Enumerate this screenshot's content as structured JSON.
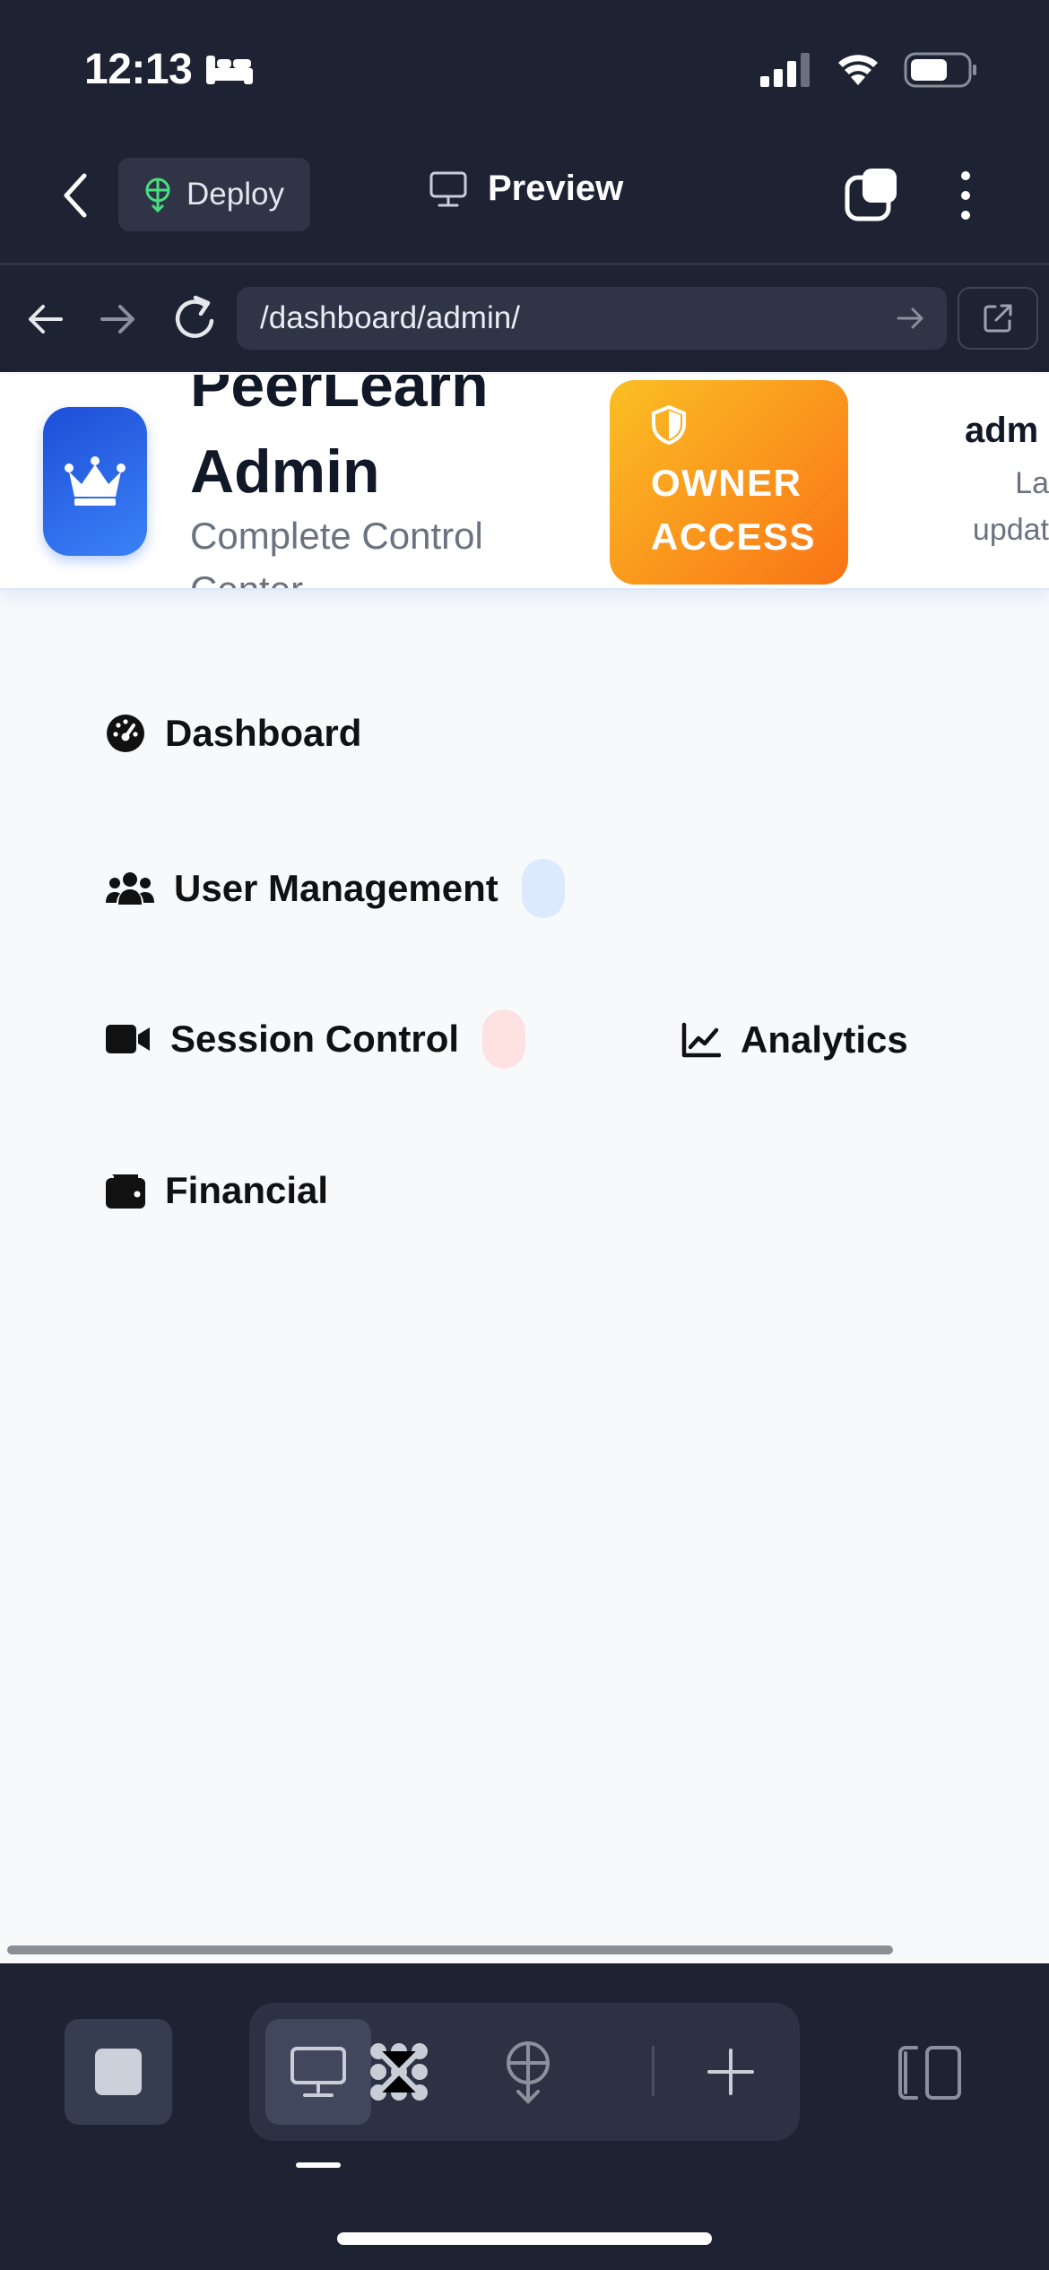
{
  "status_bar": {
    "time": "12:13"
  },
  "app_header": {
    "deploy_label": "Deploy",
    "title": "Preview"
  },
  "browser": {
    "url": "/dashboard/admin/"
  },
  "page_header": {
    "brand_title": "PeerLearn Admin",
    "brand_subtitle": "Complete Control Center",
    "owner_badge": "OWNER ACCESS",
    "admin_name": "adm",
    "admin_updated": "La updat"
  },
  "nav": {
    "dashboard": "Dashboard",
    "users": "User Management",
    "sessions": "Session Control",
    "analytics": "Analytics",
    "financial": "Financial"
  },
  "colors": {
    "chrome_bg": "#1e2333",
    "brand_blue": "#2563eb",
    "owner_gradient_start": "#fbbf24",
    "owner_gradient_end": "#f97316",
    "user_pill": "#dbeafe",
    "session_pill": "#fee2e2",
    "deploy_icon": "#4ade80"
  },
  "icons": {
    "dashboard": "gauge-icon",
    "users": "users-icon",
    "sessions": "video-icon",
    "analytics": "chart-line-icon",
    "financial": "wallet-icon"
  }
}
